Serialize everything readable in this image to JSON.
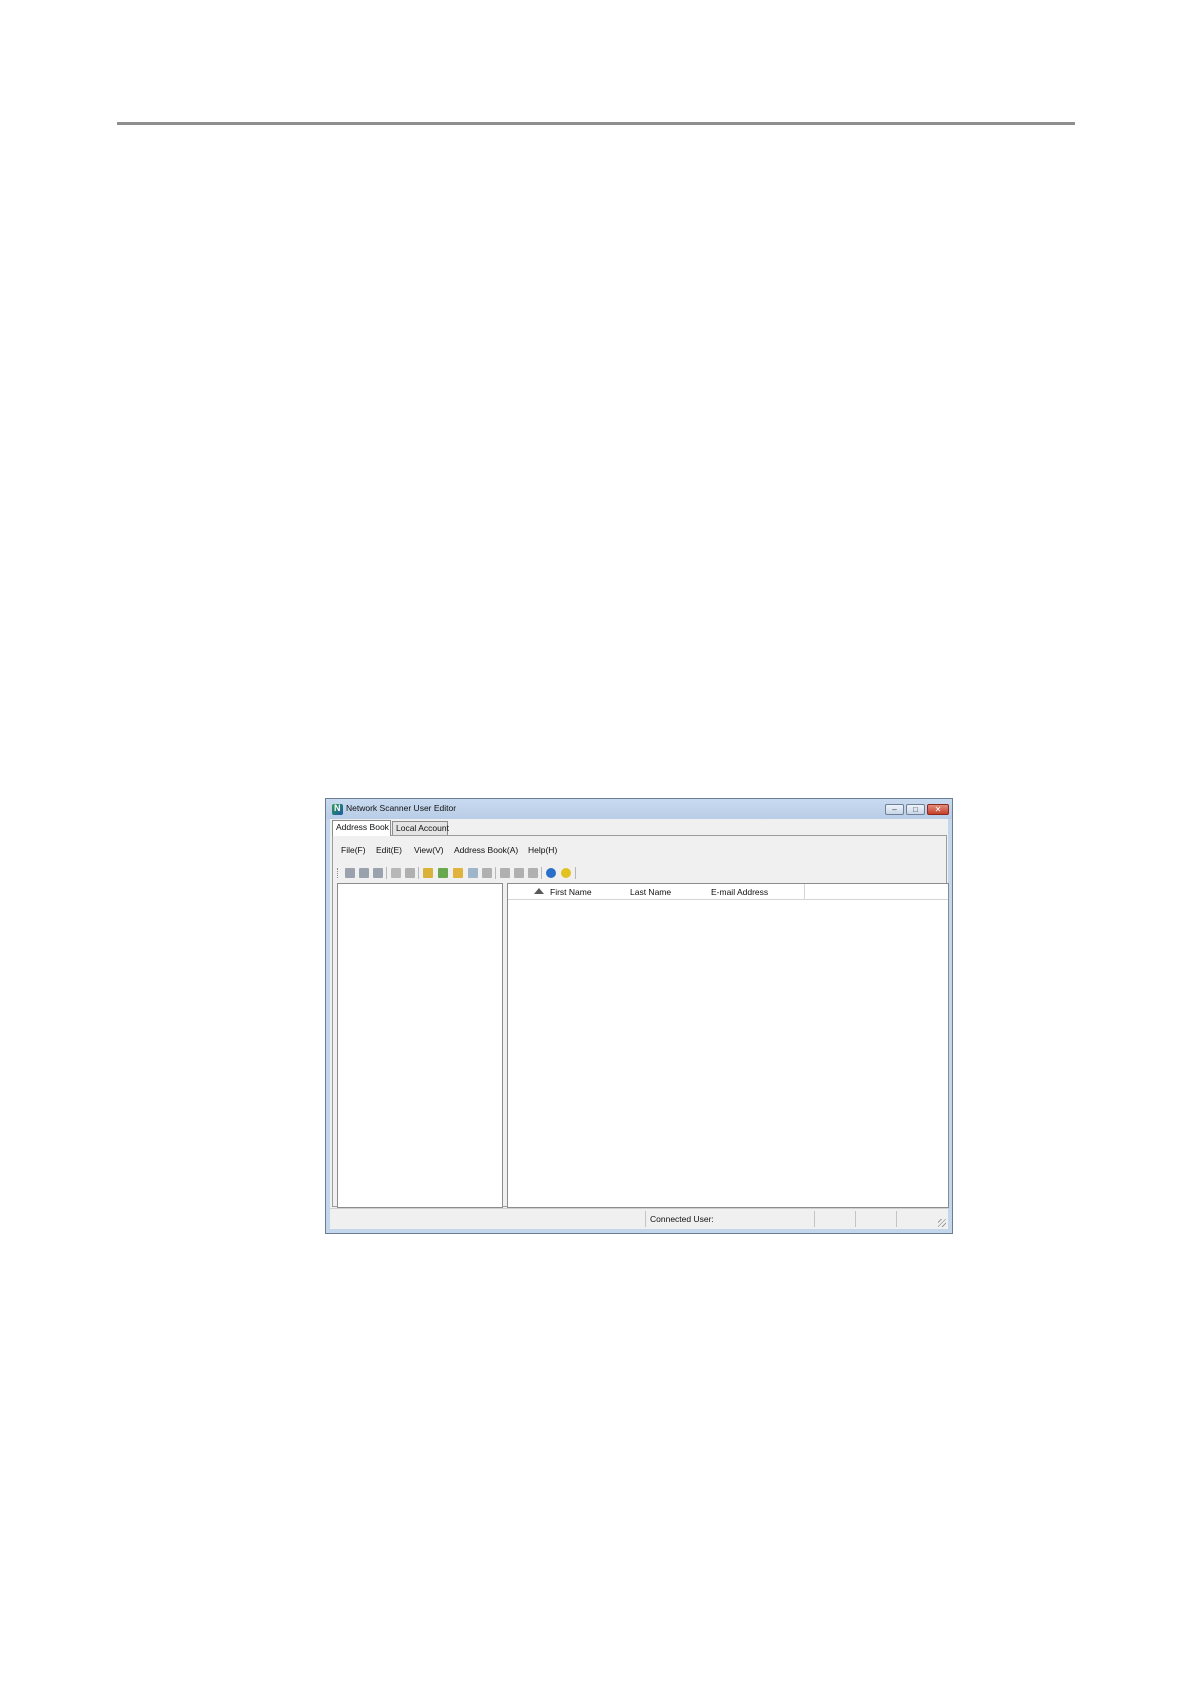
{
  "window": {
    "title": "Network Scanner User Editor",
    "minimize_glyph": "–",
    "maximize_glyph": "□",
    "close_glyph": "✕"
  },
  "tabs": [
    {
      "label": "Address Book",
      "active": true
    },
    {
      "label": "Local Account",
      "active": false
    }
  ],
  "menu": [
    "File(F)",
    "Edit(E)",
    "View(V)",
    "Address Book(A)",
    "Help(H)"
  ],
  "toolbar": {
    "buttons": [
      {
        "icon": "new-user-icon",
        "color": "#9aa3ad"
      },
      {
        "icon": "new-group-icon",
        "color": "#9aa3ad"
      },
      {
        "icon": "import-icon",
        "color": "#9aa3ad"
      },
      {
        "icon": "edit-pencil-icon",
        "color": "#b8b8b8"
      },
      {
        "icon": "properties-icon",
        "color": "#b0b0b0"
      },
      {
        "icon": "open-address-book-icon",
        "color": "#d9b23a"
      },
      {
        "icon": "save-address-book-icon",
        "color": "#6aa84f"
      },
      {
        "icon": "folder-icon",
        "color": "#e0b43c"
      },
      {
        "icon": "window-icon",
        "color": "#9fb5c9"
      },
      {
        "icon": "list-icon",
        "color": "#b0b0b0"
      },
      {
        "icon": "cut-icon",
        "color": "#b0b0b0"
      },
      {
        "icon": "copy-icon",
        "color": "#b0b0b0"
      },
      {
        "icon": "paste-icon",
        "color": "#b0b0b0"
      },
      {
        "icon": "info-icon",
        "color": "#2a6fc9"
      },
      {
        "icon": "help-icon",
        "color": "#e2c21f"
      }
    ]
  },
  "list": {
    "columns": [
      "First Name",
      "Last Name",
      "E-mail Address"
    ],
    "sort_direction": "ascending",
    "rows": []
  },
  "statusbar": {
    "connected_user_label": "Connected User:"
  }
}
